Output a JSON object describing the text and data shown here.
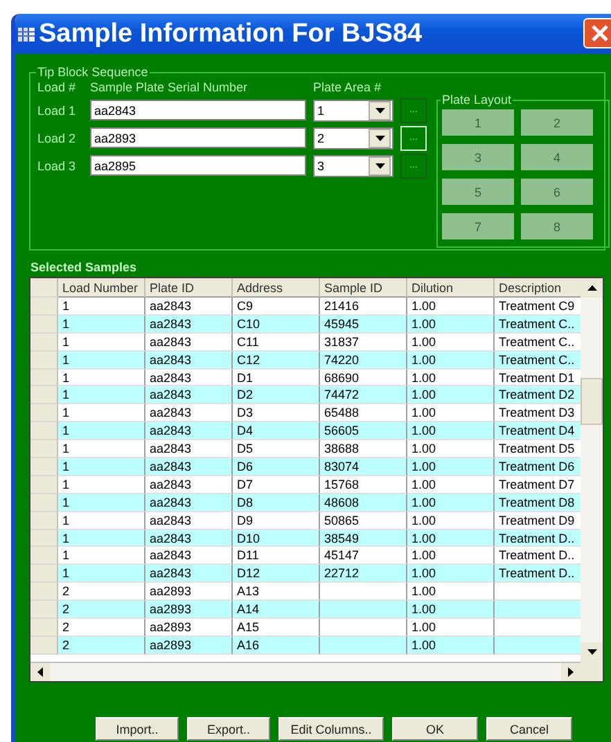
{
  "window": {
    "title": "Sample Information For BJS84"
  },
  "tip_block": {
    "title": "Tip Block Sequence",
    "headers": [
      "Load #",
      "Sample Plate Serial Number",
      "Plate Area #"
    ],
    "loads": [
      {
        "label": "Load 1",
        "serial": "aa2843",
        "area": "1",
        "browse": "...",
        "focused": false
      },
      {
        "label": "Load 2",
        "serial": "aa2893",
        "area": "2",
        "browse": "...",
        "focused": true
      },
      {
        "label": "Load 3",
        "serial": "aa2895",
        "area": "3",
        "browse": "...",
        "focused": false
      }
    ]
  },
  "plate_layout": {
    "title": "Plate Layout",
    "wells": [
      "1",
      "2",
      "3",
      "4",
      "5",
      "6",
      "7",
      "8"
    ]
  },
  "samples": {
    "title": "Selected Samples",
    "columns": [
      "Load Number",
      "Plate ID",
      "Address",
      "Sample ID",
      "Dilution",
      "Description"
    ],
    "rows": [
      {
        "load": "1",
        "plate_id": "aa2843",
        "address": "C9",
        "sample_id": "21416",
        "dilution": "1.00",
        "description": "Treatment C9"
      },
      {
        "load": "1",
        "plate_id": "aa2843",
        "address": "C10",
        "sample_id": "45945",
        "dilution": "1.00",
        "description": "Treatment C.."
      },
      {
        "load": "1",
        "plate_id": "aa2843",
        "address": "C11",
        "sample_id": "31837",
        "dilution": "1.00",
        "description": "Treatment C.."
      },
      {
        "load": "1",
        "plate_id": "aa2843",
        "address": "C12",
        "sample_id": "74220",
        "dilution": "1.00",
        "description": "Treatment C.."
      },
      {
        "load": "1",
        "plate_id": "aa2843",
        "address": "D1",
        "sample_id": "68690",
        "dilution": "1.00",
        "description": "Treatment D1"
      },
      {
        "load": "1",
        "plate_id": "aa2843",
        "address": "D2",
        "sample_id": "74472",
        "dilution": "1.00",
        "description": "Treatment D2"
      },
      {
        "load": "1",
        "plate_id": "aa2843",
        "address": "D3",
        "sample_id": "65488",
        "dilution": "1.00",
        "description": "Treatment D3"
      },
      {
        "load": "1",
        "plate_id": "aa2843",
        "address": "D4",
        "sample_id": "56605",
        "dilution": "1.00",
        "description": "Treatment D4"
      },
      {
        "load": "1",
        "plate_id": "aa2843",
        "address": "D5",
        "sample_id": "38688",
        "dilution": "1.00",
        "description": "Treatment D5"
      },
      {
        "load": "1",
        "plate_id": "aa2843",
        "address": "D6",
        "sample_id": "83074",
        "dilution": "1.00",
        "description": "Treatment D6"
      },
      {
        "load": "1",
        "plate_id": "aa2843",
        "address": "D7",
        "sample_id": "15768",
        "dilution": "1.00",
        "description": "Treatment D7"
      },
      {
        "load": "1",
        "plate_id": "aa2843",
        "address": "D8",
        "sample_id": "48608",
        "dilution": "1.00",
        "description": "Treatment D8"
      },
      {
        "load": "1",
        "plate_id": "aa2843",
        "address": "D9",
        "sample_id": "50865",
        "dilution": "1.00",
        "description": "Treatment D9"
      },
      {
        "load": "1",
        "plate_id": "aa2843",
        "address": "D10",
        "sample_id": "38549",
        "dilution": "1.00",
        "description": "Treatment D.."
      },
      {
        "load": "1",
        "plate_id": "aa2843",
        "address": "D11",
        "sample_id": "45147",
        "dilution": "1.00",
        "description": "Treatment D.."
      },
      {
        "load": "1",
        "plate_id": "aa2843",
        "address": "D12",
        "sample_id": "22712",
        "dilution": "1.00",
        "description": "Treatment D.."
      },
      {
        "load": "2",
        "plate_id": "aa2893",
        "address": "A13",
        "dilution": "1.00"
      },
      {
        "load": "2",
        "plate_id": "aa2893",
        "address": "A14",
        "dilution": "1.00"
      },
      {
        "load": "2",
        "plate_id": "aa2893",
        "address": "A15",
        "dilution": "1.00"
      },
      {
        "load": "2",
        "plate_id": "aa2893",
        "address": "A16",
        "dilution": "1.00"
      }
    ]
  },
  "buttons": [
    "Import..",
    "Export..",
    "Edit Columns..",
    "OK",
    "Cancel"
  ]
}
